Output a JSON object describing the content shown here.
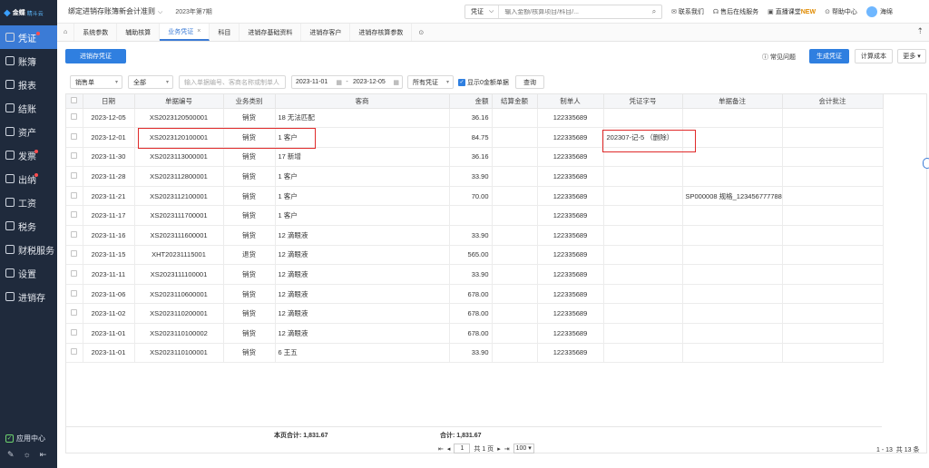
{
  "sidebar": {
    "logo": {
      "mark": "◆",
      "brand": "金蝶",
      "product": "精斗云"
    },
    "items": [
      {
        "label": "凭证",
        "active": true,
        "dot": true
      },
      {
        "label": "账簿",
        "active": false,
        "dot": false
      },
      {
        "label": "报表",
        "active": false,
        "dot": false
      },
      {
        "label": "结账",
        "active": false,
        "dot": false
      },
      {
        "label": "资产",
        "active": false,
        "dot": false
      },
      {
        "label": "发票",
        "active": false,
        "dot": true
      },
      {
        "label": "出纳",
        "active": false,
        "dot": true
      },
      {
        "label": "工资",
        "active": false,
        "dot": false
      },
      {
        "label": "税务",
        "active": false,
        "dot": false
      },
      {
        "label": "财税服务",
        "active": false,
        "dot": false
      },
      {
        "label": "设置",
        "active": false,
        "dot": false
      },
      {
        "label": "进销存",
        "active": false,
        "dot": false
      }
    ],
    "app_center": "应用中心"
  },
  "topbar": {
    "book": "绑定进销存账簿新会计准则",
    "period": "2023年第7期",
    "search_type": "凭证",
    "search_placeholder": "输入金额/核算项目/科目/...",
    "links": {
      "contact": "联系我们",
      "service": "售后在线服务",
      "live": "直播课堂",
      "new": "NEW",
      "help": "帮助中心",
      "user": "海绵"
    }
  },
  "tabs": [
    "系统参数",
    "辅助核算",
    "业务凭证",
    "科目",
    "进销存基础资料",
    "进销存客户",
    "进销存核算参数"
  ],
  "toolbar": {
    "save_voucher": "进销存凭证",
    "faq": "常见问题",
    "generate": "生成凭证",
    "calc_cost": "计算成本",
    "more": "更多"
  },
  "filters": {
    "doc_type": "销售单",
    "scope": "全部",
    "keyword_placeholder": "输入单据编号、客商名称或制单人",
    "date_from": "2023-11-01",
    "date_to": "2023-12-05",
    "voucher_status": "所有凭证",
    "show_zero": "显示0金额单据",
    "query": "查询"
  },
  "table": {
    "headers": [
      "",
      "日期",
      "单据编号",
      "业务类别",
      "客商",
      "金额",
      "结算金额",
      "制单人",
      "凭证字号",
      "单据备注",
      "会计批注"
    ],
    "rows": [
      {
        "date": "2023-12-05",
        "no": "XS2023120500001",
        "type": "销货",
        "customer": "18 无法匹配",
        "amount": "36.16",
        "settle": "",
        "maker": "122335689",
        "voucher": "",
        "remark": "",
        "note": ""
      },
      {
        "date": "2023-12-01",
        "no": "XS2023120100001",
        "type": "销货",
        "customer": "1 客户",
        "amount": "84.75",
        "settle": "",
        "maker": "122335689",
        "voucher": "202307-记-5 （删除）",
        "remark": "",
        "note": ""
      },
      {
        "date": "2023-11-30",
        "no": "XS2023113000001",
        "type": "销货",
        "customer": "17 新增",
        "amount": "36.16",
        "settle": "",
        "maker": "122335689",
        "voucher": "",
        "remark": "",
        "note": ""
      },
      {
        "date": "2023-11-28",
        "no": "XS2023112800001",
        "type": "销货",
        "customer": "1 客户",
        "amount": "33.90",
        "settle": "",
        "maker": "122335689",
        "voucher": "",
        "remark": "",
        "note": ""
      },
      {
        "date": "2023-11-21",
        "no": "XS2023112100001",
        "type": "销货",
        "customer": "1 客户",
        "amount": "70.00",
        "settle": "",
        "maker": "122335689",
        "voucher": "",
        "remark": "SP000008 规格_123456777788",
        "note": ""
      },
      {
        "date": "2023-11-17",
        "no": "XS2023111700001",
        "type": "销货",
        "customer": "1 客户",
        "amount": "",
        "settle": "",
        "maker": "122335689",
        "voucher": "",
        "remark": "",
        "note": ""
      },
      {
        "date": "2023-11-16",
        "no": "XS2023111600001",
        "type": "销货",
        "customer": "12 滴眼液",
        "amount": "33.90",
        "settle": "",
        "maker": "122335689",
        "voucher": "",
        "remark": "",
        "note": ""
      },
      {
        "date": "2023-11-15",
        "no": "XHT20231115001",
        "type": "退货",
        "customer": "12 滴眼液",
        "amount": "565.00",
        "settle": "",
        "maker": "122335689",
        "voucher": "",
        "remark": "",
        "note": ""
      },
      {
        "date": "2023-11-11",
        "no": "XS2023111100001",
        "type": "销货",
        "customer": "12 滴眼液",
        "amount": "33.90",
        "settle": "",
        "maker": "122335689",
        "voucher": "",
        "remark": "",
        "note": ""
      },
      {
        "date": "2023-11-06",
        "no": "XS2023110600001",
        "type": "销货",
        "customer": "12 滴眼液",
        "amount": "678.00",
        "settle": "",
        "maker": "122335689",
        "voucher": "",
        "remark": "",
        "note": ""
      },
      {
        "date": "2023-11-02",
        "no": "XS2023110200001",
        "type": "销货",
        "customer": "12 滴眼液",
        "amount": "678.00",
        "settle": "",
        "maker": "122335689",
        "voucher": "",
        "remark": "",
        "note": ""
      },
      {
        "date": "2023-11-01",
        "no": "XS2023110100002",
        "type": "销货",
        "customer": "12 滴眼液",
        "amount": "678.00",
        "settle": "",
        "maker": "122335689",
        "voucher": "",
        "remark": "",
        "note": ""
      },
      {
        "date": "2023-11-01",
        "no": "XS2023110100001",
        "type": "销货",
        "customer": "6 王五",
        "amount": "33.90",
        "settle": "",
        "maker": "122335689",
        "voucher": "",
        "remark": "",
        "note": ""
      }
    ],
    "page_total": "本页合计: 1,831.67",
    "grand_total": "合计: 1,831.67"
  },
  "pager": {
    "page": "1",
    "of": "共 1 页",
    "size": "100",
    "range": "1 - 13",
    "count": "共 13 条"
  },
  "colors": {
    "sidebar": "#1f2a3c",
    "accent": "#2f7fe0",
    "highlight": "#e02a2a"
  }
}
